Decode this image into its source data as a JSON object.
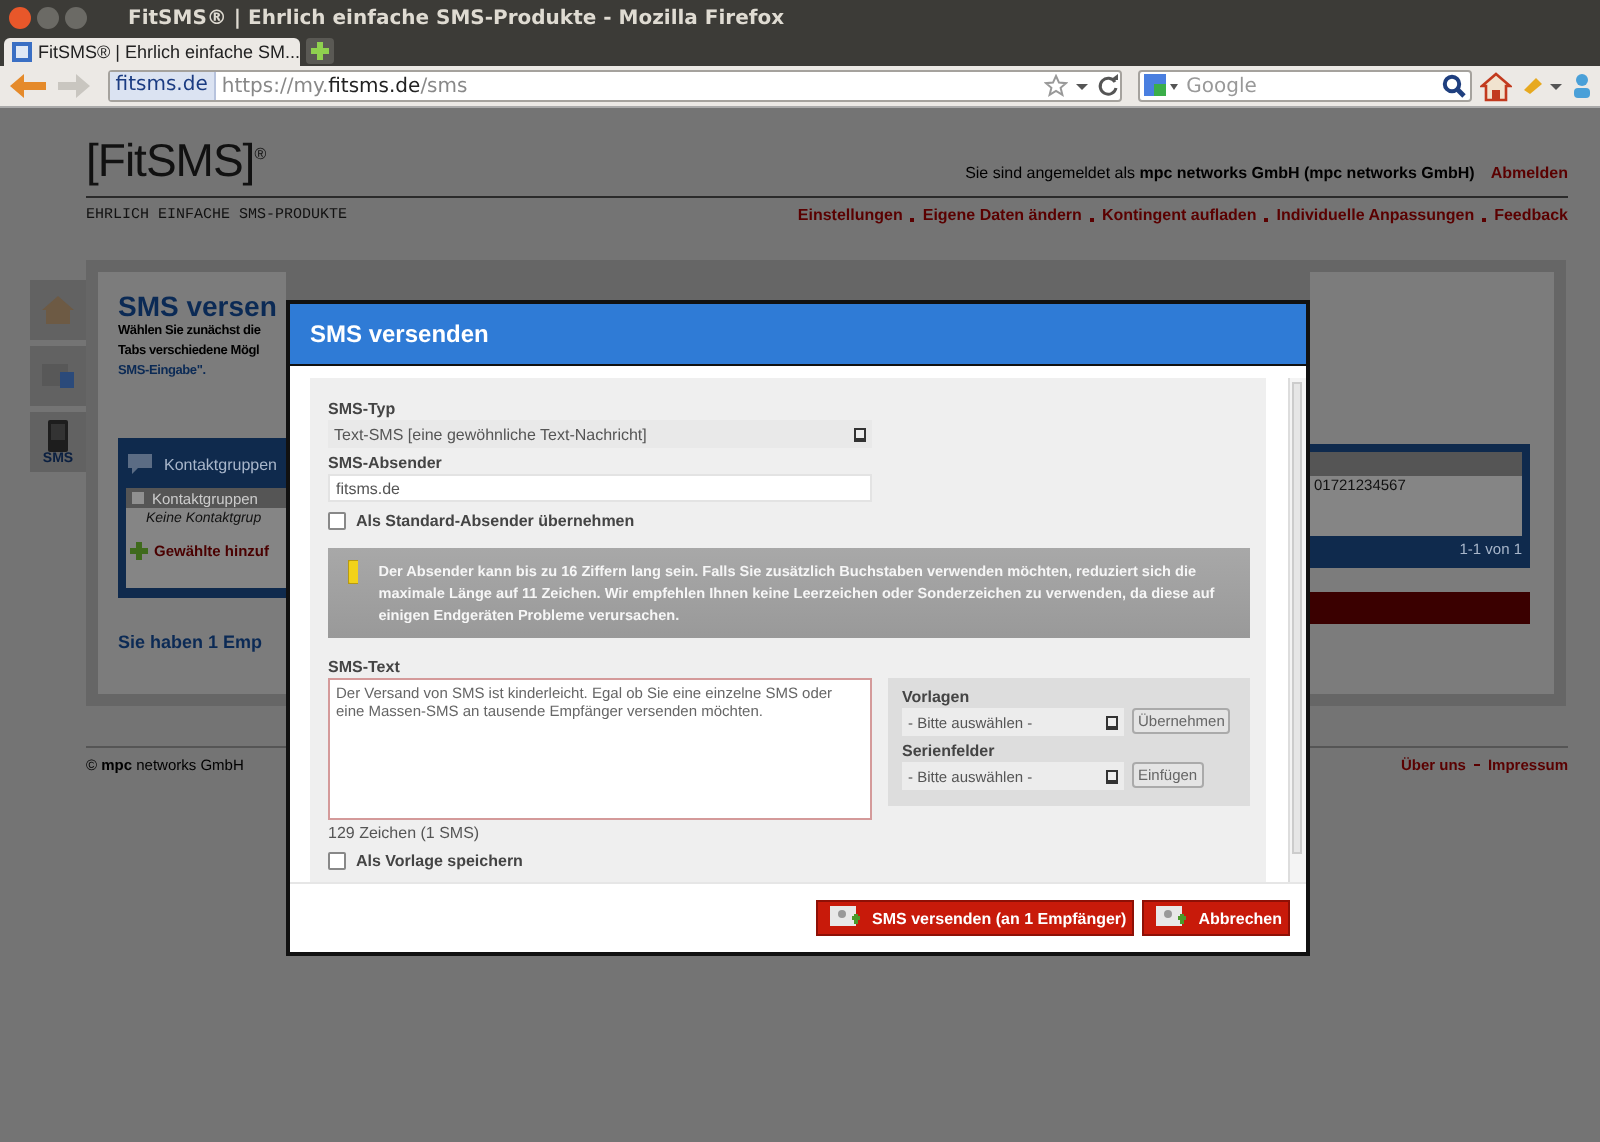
{
  "browser": {
    "window_title": "FitSMS® | Ehrlich einfache SMS-Produkte - Mozilla Firefox",
    "tab_title": "FitSMS® | Ehrlich einfache SM...",
    "site_badge": "fitsms.de",
    "url": "https://my.**fitsms.de**/sms",
    "search_placeholder": "Google"
  },
  "page": {
    "logo": "[Fit**SMS**]",
    "logo_mark": "®",
    "login": "Sie sind angemeldet als **mpc networks GmbH (mpc networks GmbH)**",
    "logout": "Abmelden",
    "tagline": "EHRLICH EINFACHE SMS-PRODUKTE",
    "nav_links": [
      "Einstellungen",
      "Eigene Daten ändern",
      "Kontingent aufladen",
      "Individuelle Anpassungen",
      "Feedback"
    ],
    "sidebar": [
      {
        "kind": "home"
      },
      {
        "kind": "contacts"
      },
      {
        "kind": "sms",
        "label": "SMS"
      }
    ],
    "heading": "SMS versen",
    "intro": [
      "Wählen Sie zunächst die",
      "Tabs verschiedene Mögl"
    ],
    "intro_link": "SMS-Eingabe\".",
    "tab": "Kontaktgruppen",
    "list_header": "Kontaktgruppen",
    "list_header_checked": false,
    "list_empty": "Keine Kontaktgrup",
    "add_link": "Gewählte hinzuf",
    "recipients": "Sie haben 1 Emp",
    "right_cell": "01721234567",
    "pager": "1-1 von 1",
    "footer_copy": "© **mpc** networks GmbH",
    "footer_links": [
      "Über uns",
      "Impressum"
    ]
  },
  "modal": {
    "title": "SMS versenden",
    "type_label": "SMS-Typ",
    "type_value": "Text-SMS [eine gewöhnliche Text-Nachricht]",
    "sender_label": "SMS-Absender",
    "sender_value": "fitsms.de",
    "default_checkbox": {
      "label": "Als Standard-Absender übernehmen",
      "checked": false
    },
    "warning": "Der Absender kann bis zu 16 Ziffern lang sein. Falls Sie zusätzlich Buchstaben verwenden möchten, reduziert sich die maximale Länge auf 11 Zeichen. Wir empfehlen Ihnen keine Leerzeichen oder Sonderzeichen zu verwenden, da diese auf einigen Endgeräten Probleme verursachen.",
    "text_label": "SMS-Text",
    "text_value": "Der Versand von SMS ist kinderleicht. Egal ob Sie eine einzelne SMS oder eine Massen-SMS an tausende Empfänger versenden möchten.",
    "counter": "129 Zeichen (1 SMS)",
    "save_checkbox": {
      "label": "Als Vorlage speichern",
      "checked": false
    },
    "pickers": [
      {
        "label": "Vorlagen",
        "placeholder": "- Bitte auswählen -",
        "button": "Übernehmen"
      },
      {
        "label": "Serienfelder",
        "placeholder": "- Bitte auswählen -",
        "button": "Einfügen"
      }
    ],
    "buttons": [
      "SMS versenden (an 1 Empfänger)",
      "Abbrechen"
    ]
  }
}
